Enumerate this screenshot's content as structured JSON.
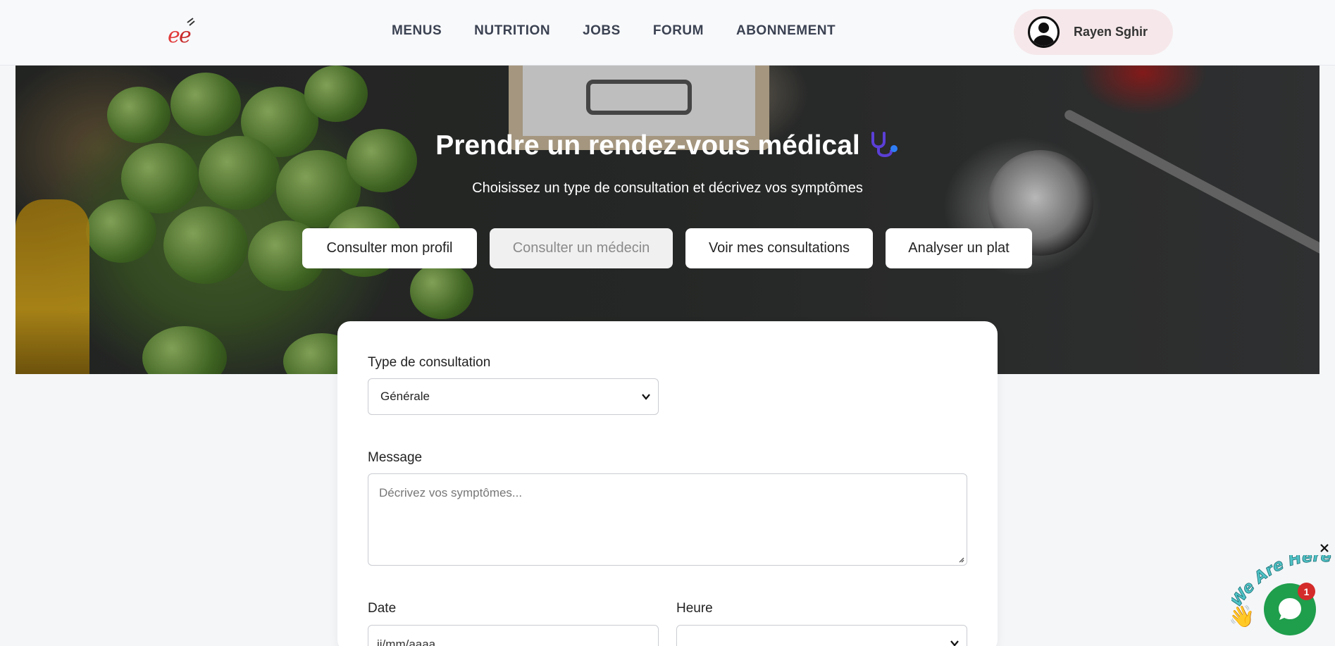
{
  "header": {
    "logo_text": "eé",
    "nav": [
      {
        "label": "MENUS"
      },
      {
        "label": "NUTRITION"
      },
      {
        "label": "JOBS"
      },
      {
        "label": "FORUM"
      },
      {
        "label": "ABONNEMENT"
      }
    ],
    "user_name": "Rayen Sghir"
  },
  "hero": {
    "title": "Prendre un rendez-vous médical",
    "subtitle": "Choisissez un type de consultation et décrivez vos symptômes",
    "tabs": [
      {
        "label": "Consulter mon profil",
        "active": false
      },
      {
        "label": "Consulter un médecin",
        "active": true
      },
      {
        "label": "Voir mes consultations",
        "active": false
      },
      {
        "label": "Analyser un plat",
        "active": false
      }
    ]
  },
  "form": {
    "type_label": "Type de consultation",
    "type_value": "Générale",
    "message_label": "Message",
    "message_placeholder": "Décrivez vos symptômes...",
    "date_label": "Date",
    "date_placeholder": "jj/mm/aaaa",
    "time_label": "Heure",
    "time_value": ""
  },
  "chat": {
    "badge_text": "We Are Here!",
    "unread_count": "1"
  },
  "colors": {
    "chat_green": "#1f9e4c",
    "badge_red": "#d42b2b",
    "user_pill": "#f6e8ea",
    "stethoscope_icon": "#5b3fd6"
  }
}
